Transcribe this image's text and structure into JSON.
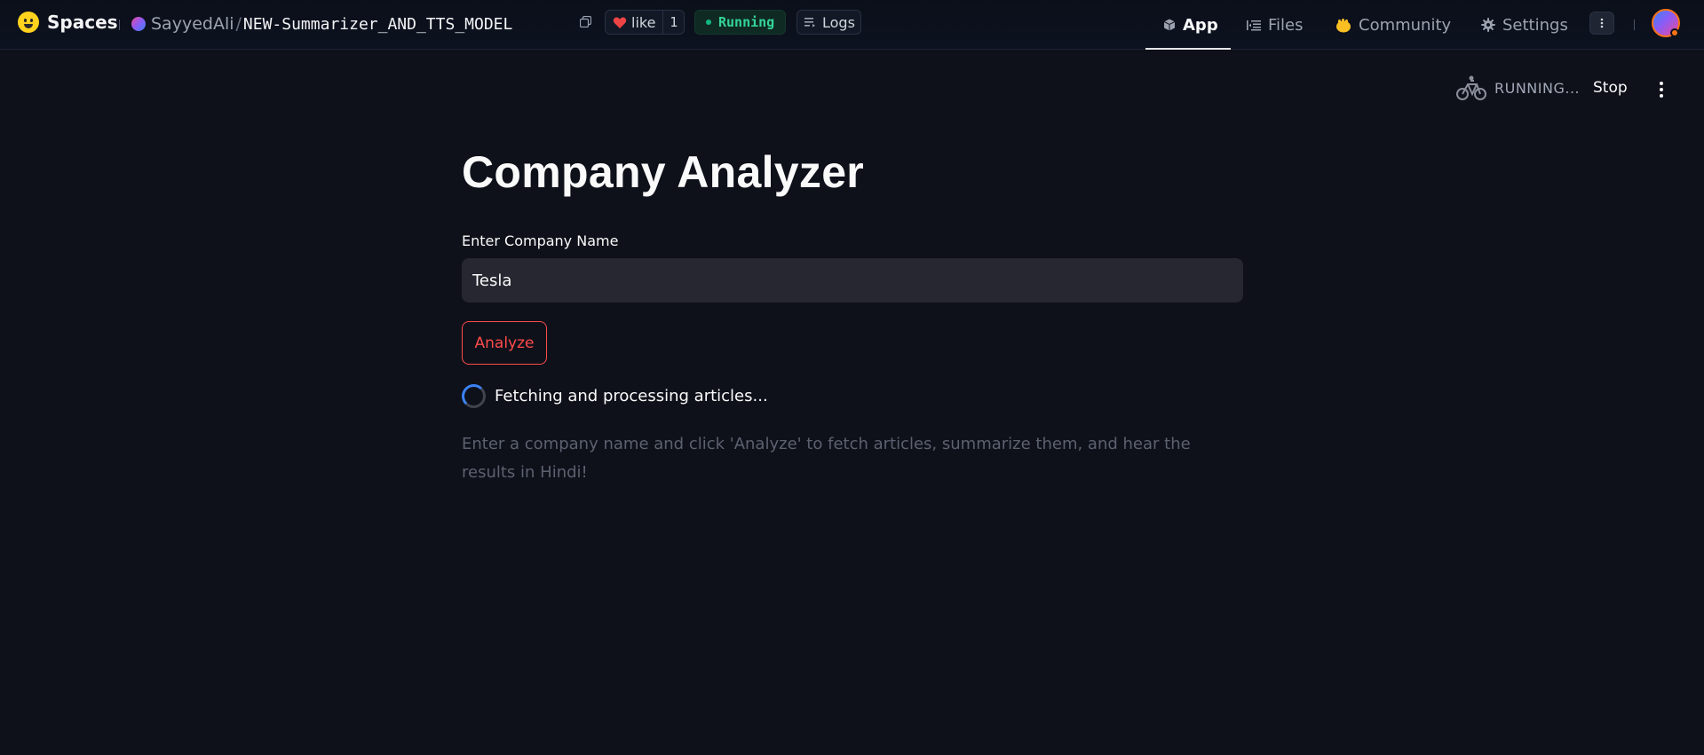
{
  "navbar": {
    "brand": "Spaces",
    "repo_owner": "SayyedAli",
    "repo_slash": "/",
    "repo_name": "NEW-Summarizer_AND_TTS_MODEL",
    "like_label": "like",
    "like_count": "1",
    "status_label": "Running",
    "logs_label": "Logs",
    "tabs": [
      {
        "label": "App",
        "active": true
      },
      {
        "label": "Files",
        "active": false
      },
      {
        "label": "Community",
        "active": false
      },
      {
        "label": "Settings",
        "active": false
      }
    ],
    "icons": {
      "brand": "huggingface-logo-icon",
      "copy": "copy-icon",
      "like": "heart-icon",
      "logs": "logs-icon",
      "app": "cube-icon",
      "files": "files-icon",
      "community": "community-hand-icon",
      "settings": "gear-icon",
      "more": "vertical-dots-icon"
    },
    "colors": {
      "like_heart": "#ef4444",
      "running": "#34d399",
      "avatar_ring": "#f97316"
    }
  },
  "app_status": {
    "running_label": "RUNNING...",
    "stop_label": "Stop",
    "icons": {
      "running": "bicycle-icon",
      "menu": "kebab-menu-icon"
    }
  },
  "app": {
    "title": "Company Analyzer",
    "input_label": "Enter Company Name",
    "input_value": "Tesla",
    "button_label": "Analyze",
    "spinner_text": "Fetching and processing articles...",
    "hint": "Enter a company name and click 'Analyze' to fetch articles, summarize them, and hear the results in Hindi!",
    "colors": {
      "accent": "#ff4b4b",
      "spinner": "#3b82f6"
    }
  }
}
